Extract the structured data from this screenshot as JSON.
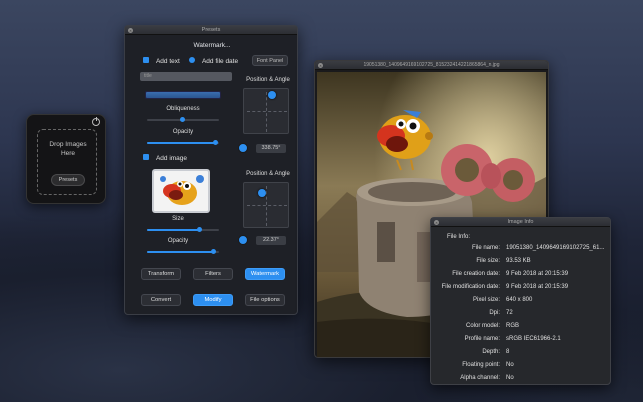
{
  "drop_widget": {
    "label_line1": "Drop Images",
    "label_line2": "Here",
    "presets_button": "Presets"
  },
  "presets_panel": {
    "title": "Presets",
    "watermark_title": "Watermark...",
    "add_text": {
      "label": "Add text",
      "checked": true
    },
    "add_file_date": {
      "label": "Add file date",
      "checked": true
    },
    "font_panel_button": "Font Panel",
    "text_field_value": "title",
    "position_angle_label": "Position & Angle",
    "obliqueness_label": "Obliqueness",
    "opacity_label": "Opacity",
    "text_angle_value": "338.75°",
    "add_image": {
      "label": "Add image",
      "checked": true
    },
    "image_position_angle_label": "Position & Angle",
    "size_label": "Size",
    "image_opacity_label": "Opacity",
    "image_angle_value": "22.37°",
    "tabs": [
      {
        "label": "Transform",
        "active": false
      },
      {
        "label": "Filters",
        "active": false
      },
      {
        "label": "Watermark",
        "active": true
      }
    ],
    "actions": [
      {
        "label": "Convert",
        "active": false
      },
      {
        "label": "Modify",
        "active": true
      },
      {
        "label": "File options",
        "active": false
      }
    ],
    "accent": "#2d8ff0"
  },
  "viewer": {
    "title": "19051380_1409649169102725_815232414221865864_n.jpg"
  },
  "image_info": {
    "title": "Image Info",
    "header": "File Info:",
    "rows": [
      {
        "key": "File name:",
        "value": "19051380_1409649169102725_61..."
      },
      {
        "key": "File size:",
        "value": "93.53 KB"
      },
      {
        "key": "File creation date:",
        "value": "9 Feb 2018 at 20:15:39"
      },
      {
        "key": "File modification date:",
        "value": "9 Feb 2018 at 20:15:39"
      },
      {
        "key": "Pixel size:",
        "value": "640 x 800"
      },
      {
        "key": "Dpi:",
        "value": "72"
      },
      {
        "key": "Color model:",
        "value": "RGB"
      },
      {
        "key": "Profile name:",
        "value": "sRGB IEC61966-2.1"
      },
      {
        "key": "Depth:",
        "value": "8"
      },
      {
        "key": "Floating point:",
        "value": "No"
      },
      {
        "key": "Alpha channel:",
        "value": "No"
      }
    ]
  }
}
